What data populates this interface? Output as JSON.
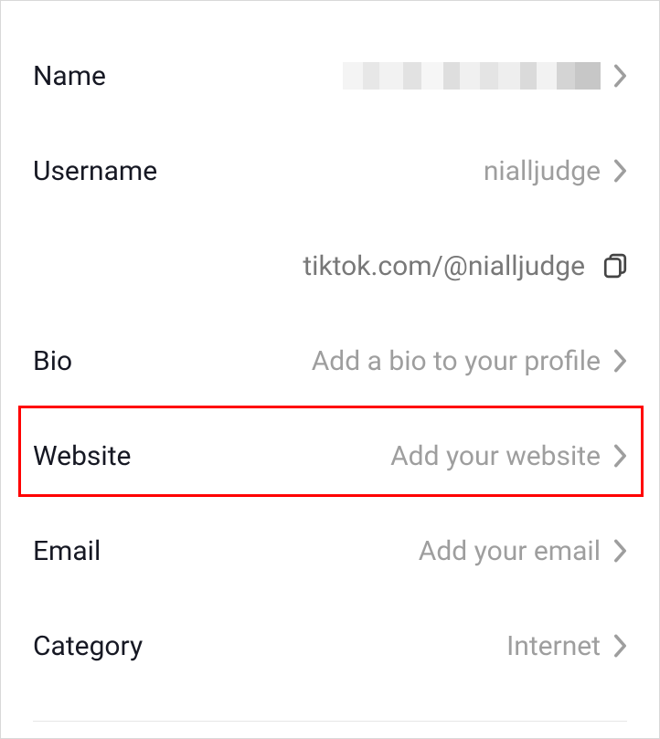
{
  "rows": {
    "name": {
      "label": "Name",
      "value": ""
    },
    "username": {
      "label": "Username",
      "value": "nialljudge"
    },
    "url": {
      "text": "tiktok.com/@nialljudge"
    },
    "bio": {
      "label": "Bio",
      "value": "Add a bio to your profile"
    },
    "website": {
      "label": "Website",
      "value": "Add your website"
    },
    "email": {
      "label": "Email",
      "value": "Add your email"
    },
    "category": {
      "label": "Category",
      "value": "Internet"
    }
  }
}
